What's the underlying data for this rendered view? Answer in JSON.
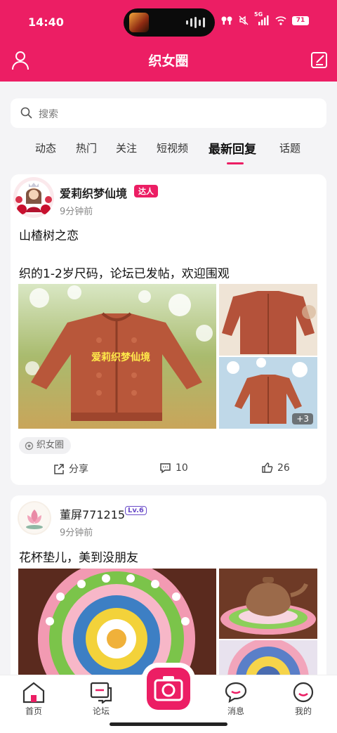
{
  "status_bar": {
    "time": "14:40",
    "network": "5G",
    "battery": "71"
  },
  "header": {
    "title": "织女圈"
  },
  "search": {
    "placeholder": "搜索"
  },
  "tabs": [
    {
      "label": "动态"
    },
    {
      "label": "热门"
    },
    {
      "label": "关注"
    },
    {
      "label": "短视频"
    },
    {
      "label": "最新回复",
      "active": true
    },
    {
      "label": "话题"
    }
  ],
  "posts": [
    {
      "author": "爱莉织梦仙境",
      "badge": "达人",
      "time": "9分钟前",
      "title": "山楂树之恋",
      "body": "织的1-2岁尺码，论坛已发帖，欢迎围观",
      "image_caption": "爱莉织梦仙境",
      "more_images": "+3",
      "topic": "织女圈",
      "share_label": "分享",
      "comments": "10",
      "likes": "26"
    },
    {
      "author": "董屏771215",
      "level": "Lv.6",
      "time": "9分钟前",
      "title": "花杯垫儿，美到没朋友"
    }
  ],
  "bottom_nav": [
    {
      "label": "首页"
    },
    {
      "label": "论坛"
    },
    {
      "label": "消息"
    },
    {
      "label": "我的"
    }
  ],
  "colors": {
    "brand": "#ec1e64",
    "level_badge": "#6b4cc9"
  }
}
